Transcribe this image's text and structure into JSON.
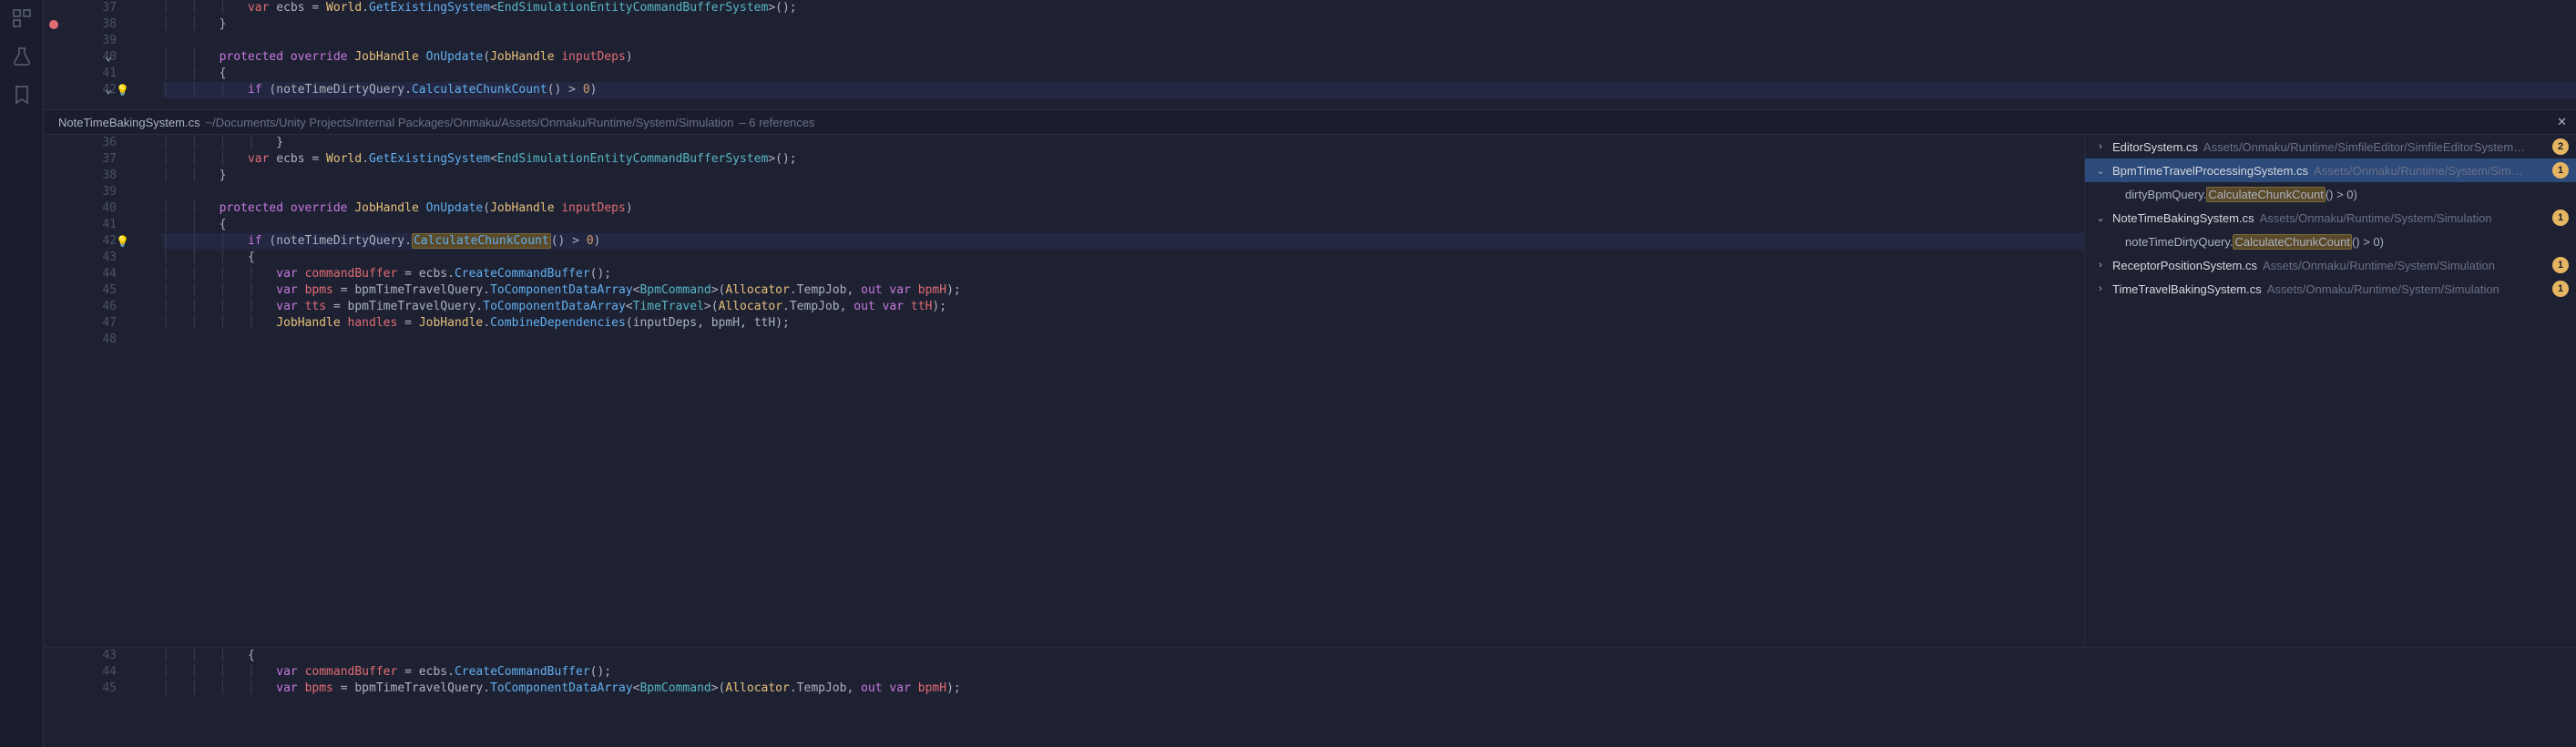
{
  "topEditor": {
    "lines": [
      {
        "n": 37,
        "breakpoint": false,
        "indent": 3,
        "tokens": [
          [
            "var",
            "local"
          ],
          [
            " ecbs ",
            "punct"
          ],
          [
            "= ",
            "punct"
          ],
          [
            "World",
            "type"
          ],
          [
            ".",
            "punct"
          ],
          [
            "GetExistingSystem",
            "method"
          ],
          [
            "<",
            "punct"
          ],
          [
            "EndSimulationEntityCommandBufferSystem",
            "generic"
          ],
          [
            ">();",
            "punct"
          ]
        ]
      },
      {
        "n": 38,
        "breakpoint": true,
        "indent": 2,
        "tokens": [
          [
            "}",
            "punct"
          ]
        ]
      },
      {
        "n": 39,
        "indent": 0,
        "tokens": []
      },
      {
        "n": 40,
        "fold": true,
        "indent": 2,
        "tokens": [
          [
            "protected override ",
            "kw"
          ],
          [
            "JobHandle ",
            "type"
          ],
          [
            "OnUpdate",
            "method"
          ],
          [
            "(",
            "punct"
          ],
          [
            "JobHandle ",
            "type"
          ],
          [
            "inputDeps",
            "param"
          ],
          [
            ")",
            "punct"
          ]
        ]
      },
      {
        "n": 41,
        "indent": 2,
        "tokens": [
          [
            "{",
            "punct"
          ]
        ]
      },
      {
        "n": 42,
        "fold": true,
        "bulb": true,
        "hl": true,
        "indent": 3,
        "tokens": [
          [
            "if ",
            "kw"
          ],
          [
            "(",
            "punct"
          ],
          [
            "noteTimeDirtyQuery",
            "var"
          ],
          [
            ".",
            "punct"
          ],
          [
            "CalculateChunkCount",
            "method"
          ],
          [
            "()",
            "punct"
          ],
          [
            " > ",
            "punct"
          ],
          [
            "0",
            "num"
          ],
          [
            ")",
            "punct"
          ]
        ]
      }
    ]
  },
  "refHeader": {
    "filename": "NoteTimeBakingSystem.cs",
    "path": "~/Documents/Unity Projects/Internal Packages/Onmaku/Assets/Onmaku/Runtime/System/Simulation",
    "refcount": "– 6 references"
  },
  "midEditor": {
    "lines": [
      {
        "n": 36,
        "indent": 4,
        "tokens": [
          [
            "}",
            "punct"
          ]
        ]
      },
      {
        "n": 37,
        "indent": 3,
        "tokens": [
          [
            "var",
            "local"
          ],
          [
            " ecbs ",
            "punct"
          ],
          [
            "= ",
            "punct"
          ],
          [
            "World",
            "type"
          ],
          [
            ".",
            "punct"
          ],
          [
            "GetExistingSystem",
            "method"
          ],
          [
            "<",
            "punct"
          ],
          [
            "EndSimulationEntityCommandBufferSystem",
            "generic"
          ],
          [
            ">();",
            "punct"
          ]
        ]
      },
      {
        "n": 38,
        "indent": 2,
        "tokens": [
          [
            "}",
            "punct"
          ]
        ]
      },
      {
        "n": 39,
        "indent": 0,
        "tokens": []
      },
      {
        "n": 40,
        "indent": 2,
        "tokens": [
          [
            "protected override ",
            "kw"
          ],
          [
            "JobHandle ",
            "type"
          ],
          [
            "OnUpdate",
            "method"
          ],
          [
            "(",
            "punct"
          ],
          [
            "JobHandle ",
            "type"
          ],
          [
            "inputDeps",
            "param"
          ],
          [
            ")",
            "punct"
          ]
        ]
      },
      {
        "n": 41,
        "indent": 2,
        "tokens": [
          [
            "{",
            "punct"
          ]
        ]
      },
      {
        "n": 42,
        "bulb": true,
        "hl": true,
        "indent": 3,
        "tokens": [
          [
            "if ",
            "kw"
          ],
          [
            "(",
            "punct"
          ],
          [
            "noteTimeDirtyQuery",
            "var"
          ],
          [
            ".",
            "punct"
          ],
          [
            "CalculateChunkCount",
            "method",
            true
          ],
          [
            "()",
            "punct"
          ],
          [
            " > ",
            "punct"
          ],
          [
            "0",
            "num"
          ],
          [
            ")",
            "punct"
          ]
        ]
      },
      {
        "n": 43,
        "indent": 3,
        "tokens": [
          [
            "{",
            "punct"
          ]
        ]
      },
      {
        "n": 44,
        "indent": 4,
        "tokens": [
          [
            "var ",
            "kw"
          ],
          [
            "commandBuffer",
            "local"
          ],
          [
            " = ",
            "punct"
          ],
          [
            "ecbs",
            "var"
          ],
          [
            ".",
            "punct"
          ],
          [
            "CreateCommandBuffer",
            "method"
          ],
          [
            "();",
            "punct"
          ]
        ]
      },
      {
        "n": 45,
        "indent": 4,
        "tokens": [
          [
            "var ",
            "kw"
          ],
          [
            "bpms",
            "local"
          ],
          [
            " = ",
            "punct"
          ],
          [
            "bpmTimeTravelQuery",
            "var"
          ],
          [
            ".",
            "punct"
          ],
          [
            "ToComponentDataArray",
            "method"
          ],
          [
            "<",
            "punct"
          ],
          [
            "BpmCommand",
            "generic"
          ],
          [
            ">(",
            "punct"
          ],
          [
            "Allocator",
            "type"
          ],
          [
            ".",
            "punct"
          ],
          [
            "TempJob",
            "var"
          ],
          [
            ", ",
            "punct"
          ],
          [
            "out var ",
            "kw"
          ],
          [
            "bpmH",
            "local"
          ],
          [
            ");",
            "punct"
          ]
        ]
      },
      {
        "n": 46,
        "indent": 4,
        "tokens": [
          [
            "var ",
            "kw"
          ],
          [
            "tts",
            "local"
          ],
          [
            " = ",
            "punct"
          ],
          [
            "bpmTimeTravelQuery",
            "var"
          ],
          [
            ".",
            "punct"
          ],
          [
            "ToComponentDataArray",
            "method"
          ],
          [
            "<",
            "punct"
          ],
          [
            "TimeTravel",
            "generic"
          ],
          [
            ">(",
            "punct"
          ],
          [
            "Allocator",
            "type"
          ],
          [
            ".",
            "punct"
          ],
          [
            "TempJob",
            "var"
          ],
          [
            ", ",
            "punct"
          ],
          [
            "out var ",
            "kw"
          ],
          [
            "ttH",
            "local"
          ],
          [
            ");",
            "punct"
          ]
        ]
      },
      {
        "n": 47,
        "indent": 4,
        "tokens": [
          [
            "JobHandle ",
            "type"
          ],
          [
            "handles",
            "local"
          ],
          [
            " = ",
            "punct"
          ],
          [
            "JobHandle",
            "type"
          ],
          [
            ".",
            "punct"
          ],
          [
            "CombineDependencies",
            "method"
          ],
          [
            "(",
            "punct"
          ],
          [
            "inputDeps",
            "var"
          ],
          [
            ", ",
            "punct"
          ],
          [
            "bpmH",
            "var"
          ],
          [
            ", ",
            "punct"
          ],
          [
            "ttH",
            "var"
          ],
          [
            ");",
            "punct"
          ]
        ]
      },
      {
        "n": 48,
        "indent": 0,
        "tokens": []
      }
    ]
  },
  "thirdEditor": {
    "lines": [
      {
        "n": 43,
        "indent": 3,
        "tokens": [
          [
            "{",
            "punct"
          ]
        ]
      },
      {
        "n": 44,
        "indent": 4,
        "tokens": [
          [
            "var ",
            "kw"
          ],
          [
            "commandBuffer",
            "local"
          ],
          [
            " = ",
            "punct"
          ],
          [
            "ecbs",
            "var"
          ],
          [
            ".",
            "punct"
          ],
          [
            "CreateCommandBuffer",
            "method"
          ],
          [
            "();",
            "punct"
          ]
        ]
      },
      {
        "n": 45,
        "indent": 4,
        "tokens": [
          [
            "var ",
            "kw"
          ],
          [
            "bpms",
            "local"
          ],
          [
            " = ",
            "punct"
          ],
          [
            "bpmTimeTravelQuery",
            "var"
          ],
          [
            ".",
            "punct"
          ],
          [
            "ToComponentDataArray",
            "method"
          ],
          [
            "<",
            "punct"
          ],
          [
            "BpmCommand",
            "generic"
          ],
          [
            ">(",
            "punct"
          ],
          [
            "Allocator",
            "type"
          ],
          [
            ".",
            "punct"
          ],
          [
            "TempJob",
            "var"
          ],
          [
            ", ",
            "punct"
          ],
          [
            "out var ",
            "kw"
          ],
          [
            "bpmH",
            "local"
          ],
          [
            ");",
            "punct"
          ]
        ]
      }
    ]
  },
  "refPanel": {
    "items": [
      {
        "type": "file",
        "expanded": false,
        "selected": false,
        "name": "EditorSystem.cs",
        "path": "Assets/Onmaku/Runtime/SimfileEditor/SimfileEditorSystem…",
        "count": 2
      },
      {
        "type": "file",
        "expanded": true,
        "selected": true,
        "name": "BpmTimeTravelProcessingSystem.cs",
        "path": "Assets/Onmaku/Runtime/System/Sim…",
        "count": 1
      },
      {
        "type": "match",
        "html": "dirtyBpmQuery.<span class='match-hl'>CalculateChunkCount</span>() > 0)"
      },
      {
        "type": "file",
        "expanded": true,
        "selected": false,
        "name": "NoteTimeBakingSystem.cs",
        "path": "Assets/Onmaku/Runtime/System/Simulation",
        "count": 1
      },
      {
        "type": "match",
        "html": "noteTimeDirtyQuery.<span class='match-hl'>CalculateChunkCount</span>() > 0)"
      },
      {
        "type": "file",
        "expanded": false,
        "selected": false,
        "name": "ReceptorPositionSystem.cs",
        "path": "Assets/Onmaku/Runtime/System/Simulation",
        "count": 1
      },
      {
        "type": "file",
        "expanded": false,
        "selected": false,
        "name": "TimeTravelBakingSystem.cs",
        "path": "Assets/Onmaku/Runtime/System/Simulation",
        "count": 1
      }
    ]
  }
}
